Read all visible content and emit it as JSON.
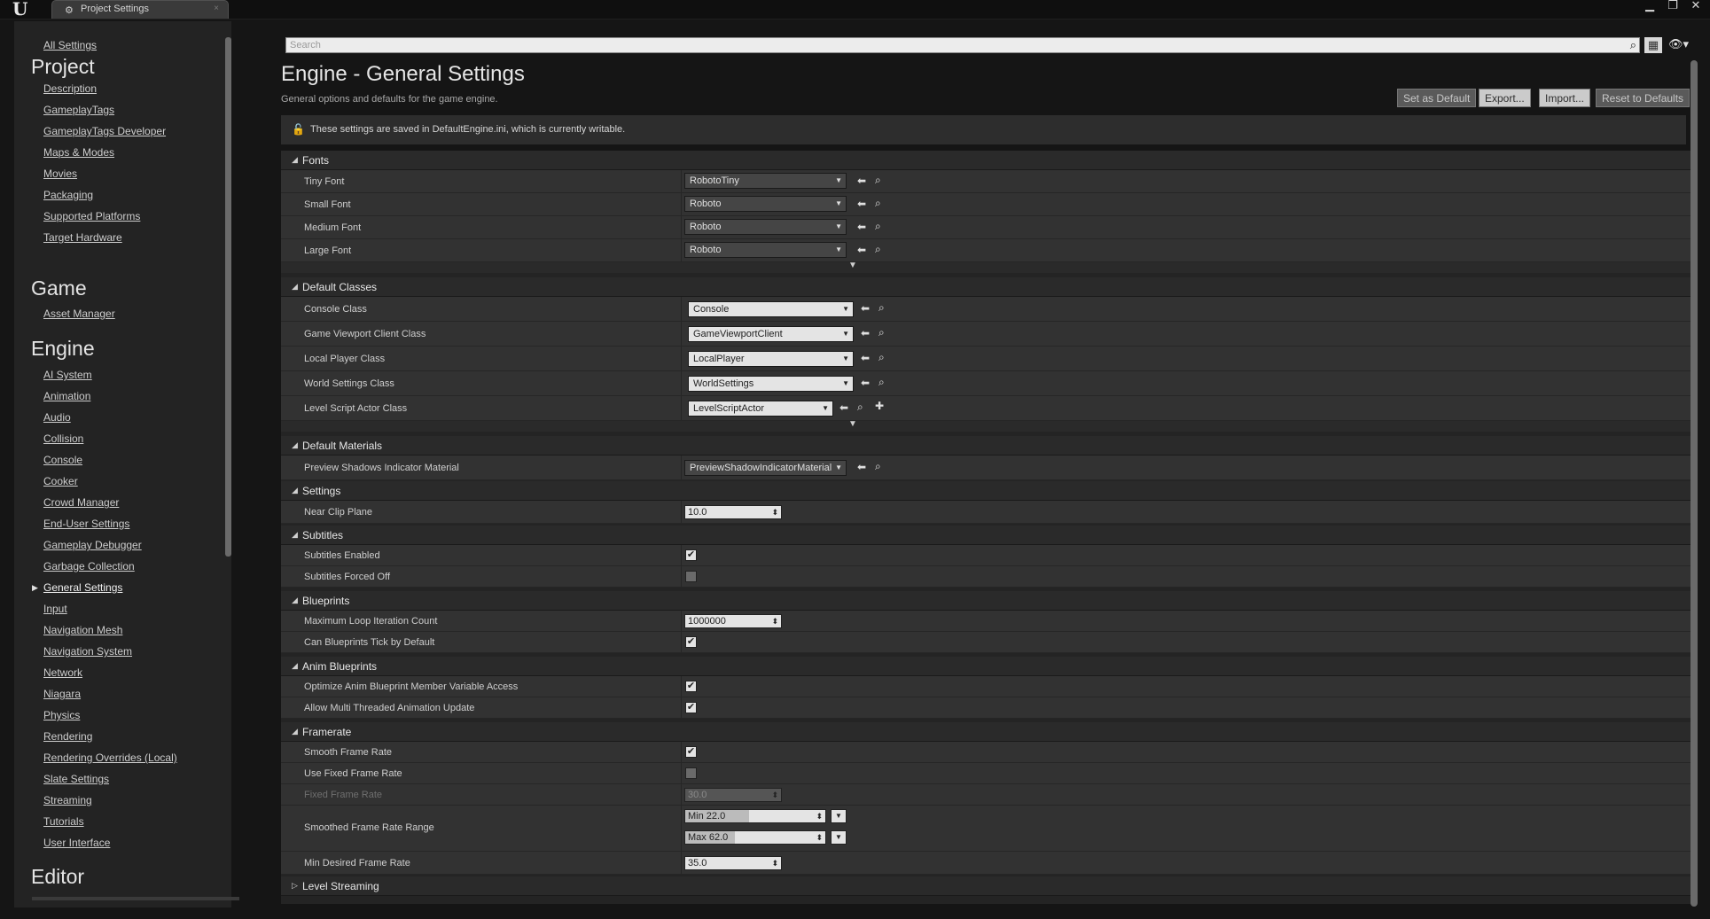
{
  "window": {
    "logo": "U",
    "tab_title": "Project Settings",
    "tab_close": "×",
    "btn_minimize": "▁",
    "btn_maximize": "❐",
    "btn_close": "✕"
  },
  "sidebar": {
    "all_settings": "All Settings",
    "project": {
      "title": "Project",
      "items": [
        "Description",
        "GameplayTags",
        "GameplayTags Developer",
        "Maps & Modes",
        "Movies",
        "Packaging",
        "Supported Platforms",
        "Target Hardware"
      ]
    },
    "game": {
      "title": "Game",
      "items": [
        "Asset Manager"
      ]
    },
    "engine": {
      "title": "Engine",
      "items": [
        "AI System",
        "Animation",
        "Audio",
        "Collision",
        "Console",
        "Cooker",
        "Crowd Manager",
        "End-User Settings",
        "Gameplay Debugger",
        "Garbage Collection",
        "General Settings",
        "Input",
        "Navigation Mesh",
        "Navigation System",
        "Network",
        "Niagara",
        "Physics",
        "Rendering",
        "Rendering Overrides (Local)",
        "Slate Settings",
        "Streaming",
        "Tutorials",
        "User Interface"
      ]
    },
    "editor": {
      "title": "Editor"
    }
  },
  "search": {
    "placeholder": "Search",
    "value": ""
  },
  "header": {
    "title": "Engine - General Settings",
    "subtitle": "General options and defaults for the game engine.",
    "buttons": {
      "set_default": "Set as Default",
      "export": "Export...",
      "import": "Import...",
      "reset": "Reset to Defaults"
    }
  },
  "notice": "These settings are saved in DefaultEngine.ini, which is currently writable.",
  "sections": {
    "fonts": {
      "title": "Fonts",
      "rows": [
        {
          "label": "Tiny Font",
          "value": "RobotoTiny"
        },
        {
          "label": "Small Font",
          "value": "Roboto"
        },
        {
          "label": "Medium Font",
          "value": "Roboto"
        },
        {
          "label": "Large Font",
          "value": "Roboto"
        }
      ]
    },
    "default_classes": {
      "title": "Default Classes",
      "rows": [
        {
          "label": "Console Class",
          "value": "Console"
        },
        {
          "label": "Game Viewport Client Class",
          "value": "GameViewportClient"
        },
        {
          "label": "Local Player Class",
          "value": "LocalPlayer"
        },
        {
          "label": "World Settings Class",
          "value": "WorldSettings"
        },
        {
          "label": "Level Script Actor Class",
          "value": "LevelScriptActor"
        }
      ]
    },
    "default_materials": {
      "title": "Default Materials",
      "rows": [
        {
          "label": "Preview Shadows Indicator Material",
          "value": "PreviewShadowIndicatorMaterial"
        }
      ]
    },
    "settings": {
      "title": "Settings",
      "rows": [
        {
          "label": "Near Clip Plane",
          "value": "10.0"
        }
      ]
    },
    "subtitles": {
      "title": "Subtitles",
      "rows": [
        {
          "label": "Subtitles Enabled",
          "checked": true
        },
        {
          "label": "Subtitles Forced Off",
          "checked": false
        }
      ]
    },
    "blueprints": {
      "title": "Blueprints",
      "rows": [
        {
          "label": "Maximum Loop Iteration Count",
          "value": "1000000"
        },
        {
          "label": "Can Blueprints Tick by Default",
          "checked": true
        }
      ]
    },
    "anim_blueprints": {
      "title": "Anim Blueprints",
      "rows": [
        {
          "label": "Optimize Anim Blueprint Member Variable Access",
          "checked": true
        },
        {
          "label": "Allow Multi Threaded Animation Update",
          "checked": true
        }
      ]
    },
    "framerate": {
      "title": "Framerate",
      "smooth": {
        "label": "Smooth Frame Rate",
        "checked": true
      },
      "use_fixed": {
        "label": "Use Fixed Frame Rate",
        "checked": false
      },
      "fixed": {
        "label": "Fixed Frame Rate",
        "value": "30.0"
      },
      "range": {
        "label": "Smoothed Frame Rate Range",
        "min": "Min  22.0",
        "max": "Max  62.0"
      },
      "min_desired": {
        "label": "Min Desired Frame Rate",
        "value": "35.0"
      }
    },
    "level_streaming": {
      "title": "Level Streaming"
    }
  }
}
